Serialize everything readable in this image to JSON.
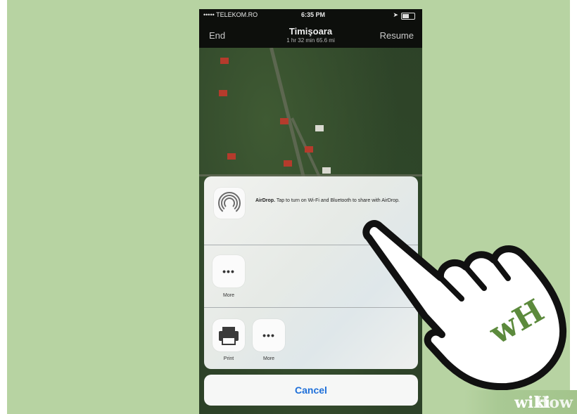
{
  "status_bar": {
    "carrier": "••••• TELEKOM.RO",
    "time": "6:35 PM"
  },
  "nav": {
    "end_label": "End",
    "title": "Timişoara",
    "subtitle": "1 hr 32 min   65.6 mi",
    "resume_label": "Resume"
  },
  "share_sheet": {
    "airdrop_title": "AirDrop.",
    "airdrop_text": " Tap to turn on Wi-Fi and Bluetooth to share with AirDrop.",
    "row1": [
      {
        "label": "More",
        "icon": "more-dots-icon"
      }
    ],
    "row2": [
      {
        "label": "Print",
        "icon": "printer-icon"
      },
      {
        "label": "More",
        "icon": "more-dots-icon"
      }
    ],
    "cancel_label": "Cancel"
  },
  "branding": {
    "wiki": "wiki",
    "how": "How",
    "hand_badge": "wH"
  },
  "colors": {
    "background": "#b7d3a2",
    "accent_blue": "#1e6fd9",
    "brand_green": "#6a9a4a"
  }
}
